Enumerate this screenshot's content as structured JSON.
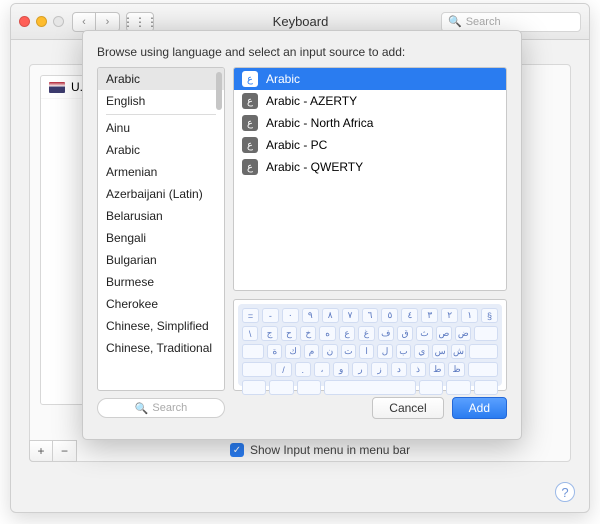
{
  "window": {
    "title": "Keyboard",
    "search_placeholder": "Search",
    "back_glyph": "‹",
    "fwd_glyph": "›",
    "grid_glyph": "⋮⋮⋮",
    "mag_glyph": "🔍"
  },
  "mainlist": {
    "items": [
      {
        "label": "U.S."
      }
    ],
    "plus": "+",
    "minus": "−"
  },
  "show_menu": {
    "check": "✓",
    "label": "Show Input menu in menu bar"
  },
  "sheet": {
    "prompt": "Browse using language and select an input source to add:",
    "languages_top": [
      {
        "label": "Arabic",
        "selected": true
      },
      {
        "label": "English"
      }
    ],
    "languages_rest": [
      {
        "label": "Ainu"
      },
      {
        "label": "Arabic"
      },
      {
        "label": "Armenian"
      },
      {
        "label": "Azerbaijani (Latin)"
      },
      {
        "label": "Belarusian"
      },
      {
        "label": "Bengali"
      },
      {
        "label": "Bulgarian"
      },
      {
        "label": "Burmese"
      },
      {
        "label": "Cherokee"
      },
      {
        "label": "Chinese, Simplified"
      },
      {
        "label": "Chinese, Traditional"
      }
    ],
    "sources": [
      {
        "label": "Arabic",
        "selected": true
      },
      {
        "label": "Arabic - AZERTY"
      },
      {
        "label": "Arabic - North Africa"
      },
      {
        "label": "Arabic - PC"
      },
      {
        "label": "Arabic - QWERTY"
      }
    ],
    "source_glyph": "ع",
    "keyboard_rows": [
      [
        "§",
        "١",
        "٢",
        "٣",
        "٤",
        "٥",
        "٦",
        "٧",
        "٨",
        "٩",
        "٠",
        "-",
        "="
      ],
      [
        "ض",
        "ص",
        "ث",
        "ق",
        "ف",
        "غ",
        "ع",
        "ه",
        "خ",
        "ح",
        "ج",
        "\\"
      ],
      [
        "ش",
        "س",
        "ي",
        "ب",
        "ل",
        "ا",
        "ت",
        "ن",
        "م",
        "ك",
        "ة"
      ],
      [
        "ظ",
        "ط",
        "ذ",
        "د",
        "ز",
        "ر",
        "و",
        "،",
        ".",
        "/"
      ]
    ],
    "search_placeholder": "Search",
    "cancel": "Cancel",
    "add": "Add"
  },
  "help_glyph": "?"
}
